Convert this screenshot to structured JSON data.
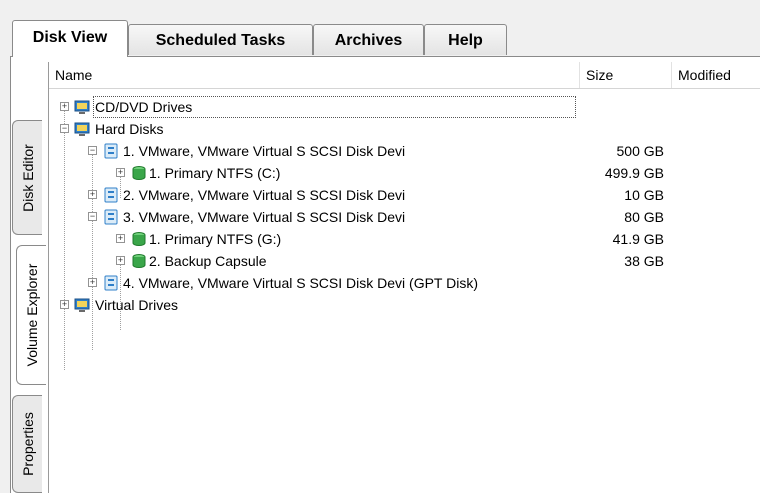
{
  "tabs": [
    {
      "label": "Disk View",
      "active": true
    },
    {
      "label": "Scheduled Tasks",
      "active": false
    },
    {
      "label": "Archives",
      "active": false
    },
    {
      "label": "Help",
      "active": false
    }
  ],
  "side_tabs": [
    {
      "label": "Disk Editor",
      "active": false
    },
    {
      "label": "Volume Explorer",
      "active": true
    },
    {
      "label": "Properties",
      "active": false
    }
  ],
  "columns": {
    "name": "Name",
    "size": "Size",
    "modified": "Modified"
  },
  "tree": [
    {
      "label": "CD/DVD Drives",
      "size": "",
      "icon": "monitor-icon",
      "expander": "+",
      "selected": true
    },
    {
      "label": "Hard Disks",
      "size": "",
      "icon": "monitor-icon",
      "expander": "-"
    },
    {
      "label": "1. VMware, VMware Virtual S SCSI Disk Devi",
      "size": "500 GB",
      "icon": "disk-icon",
      "expander": "-"
    },
    {
      "label": "1. Primary NTFS (C:)",
      "size": "499.9 GB",
      "icon": "volume-icon",
      "expander": "+"
    },
    {
      "label": "2. VMware, VMware Virtual S SCSI Disk Devi",
      "size": "10 GB",
      "icon": "disk-icon",
      "expander": "+"
    },
    {
      "label": "3. VMware, VMware Virtual S SCSI Disk Devi",
      "size": "80 GB",
      "icon": "disk-icon",
      "expander": "-"
    },
    {
      "label": "1. Primary NTFS (G:)",
      "size": "41.9 GB",
      "icon": "volume-icon",
      "expander": "+"
    },
    {
      "label": "2. Backup Capsule",
      "size": "38 GB",
      "icon": "volume-icon",
      "expander": "+"
    },
    {
      "label": "4. VMware, VMware Virtual S SCSI Disk Devi (GPT Disk)",
      "size": "",
      "icon": "disk-icon",
      "expander": "+"
    },
    {
      "label": "Virtual Drives",
      "size": "",
      "icon": "monitor-icon",
      "expander": "+"
    }
  ],
  "colors": {
    "accent": "#2f7fc9",
    "volume": "#3aa64a",
    "selection_border": "#555555"
  }
}
